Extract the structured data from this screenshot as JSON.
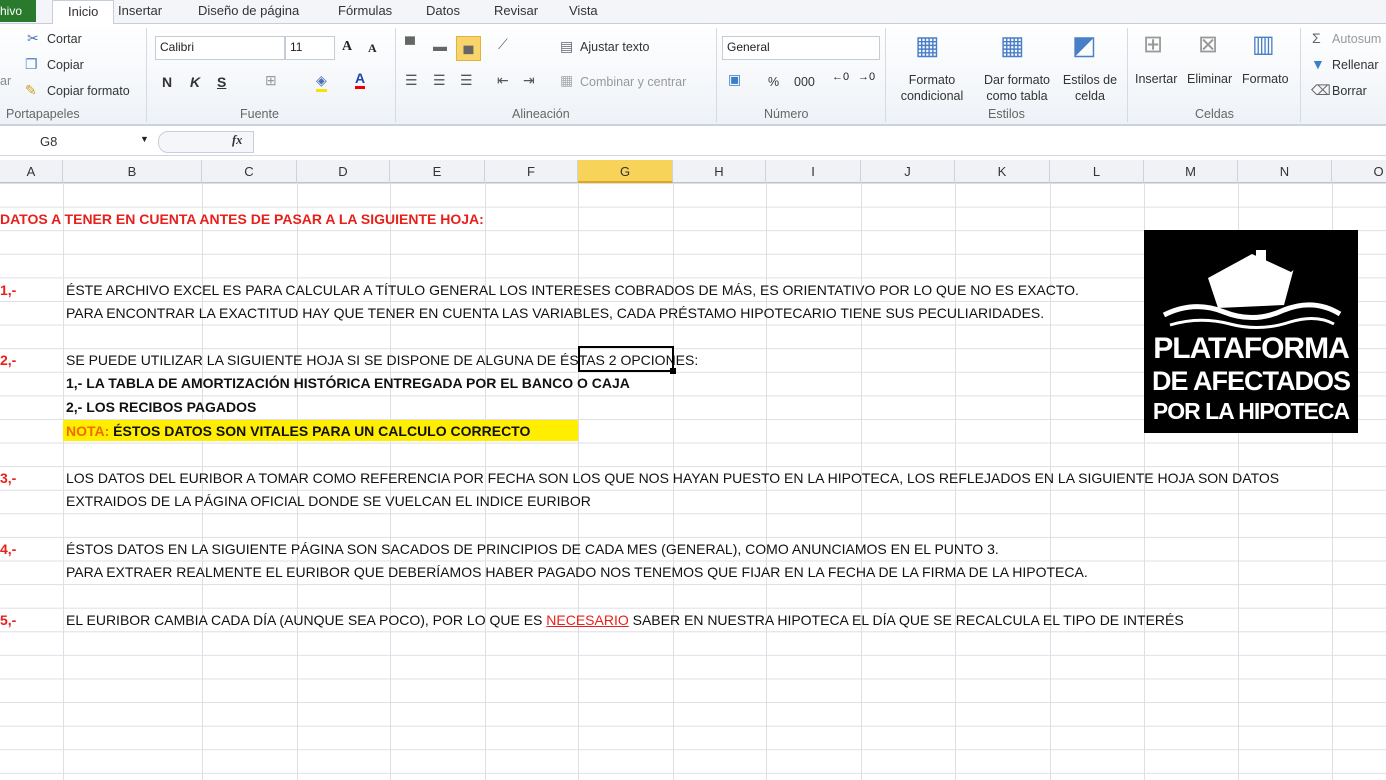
{
  "tabs": {
    "file": "hivo",
    "items": [
      "Inicio",
      "Insertar",
      "Diseño de página",
      "Fórmulas",
      "Datos",
      "Revisar",
      "Vista"
    ]
  },
  "ribbon": {
    "clipboard": {
      "paste": "ar",
      "cut": "Cortar",
      "copy": "Copiar",
      "format_painter": "Copiar formato",
      "group": "Portapapeles"
    },
    "font": {
      "name": "Calibri",
      "size": "11",
      "bold": "N",
      "italic": "K",
      "underline": "S",
      "group": "Fuente"
    },
    "alignment": {
      "wrap": "Ajustar texto",
      "merge": "Combinar y centrar",
      "group": "Alineación"
    },
    "number": {
      "format": "General",
      "percent": "%",
      "thousands": "000",
      "group": "Número"
    },
    "styles": {
      "conditional": [
        "Formato",
        "condicional"
      ],
      "table": [
        "Dar formato",
        "como tabla"
      ],
      "cell": [
        "Estilos de",
        "celda"
      ],
      "group": "Estilos"
    },
    "cells": {
      "insert": "Insertar",
      "delete": "Eliminar",
      "format": "Formato",
      "group": "Celdas"
    },
    "editing": {
      "autosum": "Autosum",
      "fill": "Rellenar",
      "clear": "Borrar"
    }
  },
  "formula_bar": {
    "name_box": "G8",
    "fx": "fx",
    "value": ""
  },
  "columns": [
    "A",
    "B",
    "C",
    "D",
    "E",
    "F",
    "G",
    "H",
    "I",
    "J",
    "K",
    "L",
    "M",
    "N",
    "O"
  ],
  "selected_column": "G",
  "sheet": {
    "title": "DATOS A TENER EN CUENTA ANTES DE PASAR A LA SIGUIENTE HOJA:",
    "n1": "1,-",
    "p1a": "ÉSTE ARCHIVO EXCEL ES PARA CALCULAR A TÍTULO GENERAL LOS INTERESES COBRADOS DE MÁS, ES ORIENTATIVO POR LO QUE NO ES EXACTO.",
    "p1b": "PARA ENCONTRAR LA EXACTITUD HAY QUE TENER EN CUENTA LAS VARIABLES, CADA PRÉSTAMO HIPOTECARIO TIENE SUS PECULIARIDADES.",
    "n2": "2,-",
    "p2a": "SE PUEDE UTILIZAR LA SIGUIENTE HOJA SI SE DISPONE DE ALGUNA DE  ÉSTAS 2 OPCIONES:",
    "p2b": "1,- LA TABLA DE AMORTIZACIÓN HISTÓRICA ENTREGADA POR EL BANCO O CAJA",
    "p2c": "2,- LOS RECIBOS PAGADOS",
    "nota_label": "NOTA:",
    "nota_text": " ÉSTOS DATOS SON VITALES PARA UN CALCULO CORRECTO",
    "n3": "3,-",
    "p3a": "LOS DATOS DEL EURIBOR A TOMAR COMO REFERENCIA POR FECHA SON LOS QUE NOS HAYAN PUESTO EN LA HIPOTECA, LOS REFLEJADOS EN LA SIGUIENTE HOJA SON DATOS",
    "p3b": "EXTRAIDOS DE LA PÁGINA OFICIAL DONDE SE VUELCAN EL INDICE EURIBOR",
    "n4": "4,-",
    "p4a": "ÉSTOS DATOS EN LA SIGUIENTE PÁGINA SON SACADOS DE PRINCIPIOS DE CADA MES (GENERAL), COMO ANUNCIAMOS EN EL PUNTO 3.",
    "p4b": "PARA EXTRAER REALMENTE EL EURIBOR QUE DEBERÍAMOS HABER PAGADO NOS TENEMOS QUE FIJAR EN LA FECHA DE LA FIRMA DE LA HIPOTECA.",
    "n5": "5,-",
    "p5a": "EL EURIBOR CAMBIA CADA DÍA (AUNQUE SEA POCO), POR LO QUE ES ",
    "p5b": "NECESARIO",
    "p5c": " SABER EN NUESTRA HIPOTECA EL DÍA QUE SE RECALCULA EL TIPO DE INTERÉS"
  },
  "logo": {
    "lines": [
      "PLATAFORMA",
      "DE AFECTADOS",
      "POR LA HIPOTECA"
    ]
  },
  "colors": {
    "accent_red": "#e8201c",
    "highlight_yellow": "#ffee00",
    "selected_header": "#f7d35a",
    "file_tab": "#2a7a2e"
  }
}
